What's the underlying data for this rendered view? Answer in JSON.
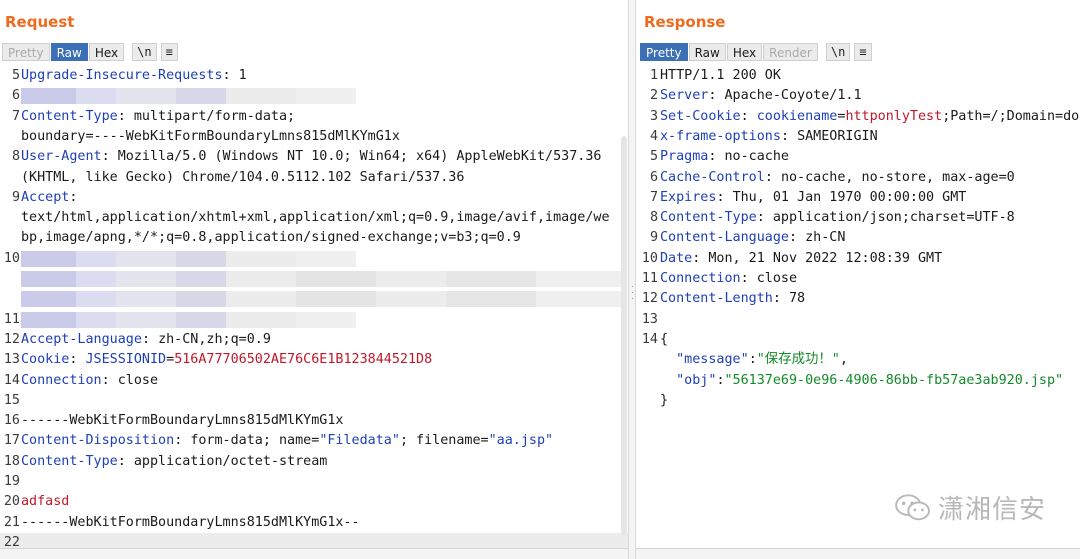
{
  "request": {
    "title": "Request",
    "tabs": [
      {
        "label": "Pretty",
        "state": "disabled"
      },
      {
        "label": "Raw",
        "state": "active"
      },
      {
        "label": "Hex",
        "state": "normal"
      }
    ],
    "newline_label": "\\n",
    "menu_label": "≡",
    "lines": [
      {
        "n": "5",
        "key": "Upgrade-Insecure-Requests",
        "sep": ": ",
        "val": "1"
      },
      {
        "n": "6",
        "redacted": true
      },
      {
        "n": "7",
        "key": "Content-Type",
        "sep": ": ",
        "val": "multipart/form-data;"
      },
      {
        "n": "",
        "val": "boundary=----WebKitFormBoundaryLmns815dMlKYmG1x"
      },
      {
        "n": "8",
        "key": "User-Agent",
        "sep": ": ",
        "val": "Mozilla/5.0 (Windows NT 10.0; Win64; x64) AppleWebKit/537.36"
      },
      {
        "n": "",
        "val": "(KHTML, like Gecko) Chrome/104.0.5112.102 Safari/537.36"
      },
      {
        "n": "9",
        "key": "Accept",
        "sep": ":",
        "val": ""
      },
      {
        "n": "",
        "val": "text/html,application/xhtml+xml,application/xml;q=0.9,image/avif,image/we"
      },
      {
        "n": "",
        "val": "bp,image/apng,*/*;q=0.8,application/signed-exchange;v=b3;q=0.9"
      },
      {
        "n": "10",
        "redacted": true
      },
      {
        "n": "",
        "redacted": true
      },
      {
        "n": "",
        "redacted": true
      },
      {
        "n": "11",
        "redacted": true
      },
      {
        "n": "12",
        "key": "Accept-Language",
        "sep": ": ",
        "val": "zh-CN,zh;q=0.9"
      },
      {
        "n": "13",
        "key": "Cookie",
        "sep": ": ",
        "ckey": "JSESSIONID",
        "ceq": "=",
        "cval": "516A77706502AE76C6E1B123844521D8"
      },
      {
        "n": "14",
        "key": "Connection",
        "sep": ": ",
        "val": "close"
      },
      {
        "n": "15",
        "val": ""
      },
      {
        "n": "16",
        "val": "------WebKitFormBoundaryLmns815dMlKYmG1x"
      },
      {
        "n": "17",
        "key": "Content-Disposition",
        "sep": ": ",
        "val": "form-data; name=",
        "q1": "\"Filedata\"",
        "mid": "; filename=",
        "q2": "\"aa.jsp\""
      },
      {
        "n": "18",
        "key": "Content-Type",
        "sep": ": ",
        "val": "application/octet-stream"
      },
      {
        "n": "19",
        "val": ""
      },
      {
        "n": "20",
        "red": "adfasd"
      },
      {
        "n": "21",
        "val": "------WebKitFormBoundaryLmns815dMlKYmG1x--"
      },
      {
        "n": "22",
        "val": ""
      }
    ]
  },
  "response": {
    "title": "Response",
    "tabs": [
      {
        "label": "Pretty",
        "state": "active"
      },
      {
        "label": "Raw",
        "state": "normal"
      },
      {
        "label": "Hex",
        "state": "normal"
      },
      {
        "label": "Render",
        "state": "disabled"
      }
    ],
    "newline_label": "\\n",
    "menu_label": "≡",
    "lines": [
      {
        "n": "1",
        "val": "HTTP/1.1 200 OK"
      },
      {
        "n": "2",
        "key": "Server",
        "sep": ": ",
        "val": "Apache-Coyote/1.1"
      },
      {
        "n": "3",
        "key": "Set-Cookie",
        "sep": ": ",
        "ckey": "cookiename",
        "ceq": "=",
        "cval": "httponlyTest",
        "rest": ";Path=/;Domain=do"
      },
      {
        "n": "4",
        "key": "x-frame-options",
        "sep": ": ",
        "val": "SAMEORIGIN"
      },
      {
        "n": "5",
        "key": "Pragma",
        "sep": ": ",
        "val": "no-cache"
      },
      {
        "n": "6",
        "key": "Cache-Control",
        "sep": ": ",
        "val": "no-cache, no-store, max-age=0"
      },
      {
        "n": "7",
        "key": "Expires",
        "sep": ": ",
        "val": "Thu, 01 Jan 1970 00:00:00 GMT"
      },
      {
        "n": "8",
        "key": "Content-Type",
        "sep": ": ",
        "val": "application/json;charset=UTF-8"
      },
      {
        "n": "9",
        "key": "Content-Language",
        "sep": ": ",
        "val": "zh-CN"
      },
      {
        "n": "10",
        "key": "Date",
        "sep": ": ",
        "val": "Mon, 21 Nov 2022 12:08:39 GMT"
      },
      {
        "n": "11",
        "key": "Connection",
        "sep": ": ",
        "val": "close"
      },
      {
        "n": "12",
        "key": "Content-Length",
        "sep": ": ",
        "val": "78"
      },
      {
        "n": "13",
        "val": ""
      },
      {
        "n": "14",
        "val": "{"
      },
      {
        "n": "",
        "indent": "  ",
        "jk": "\"message\"",
        "jc": ":",
        "jv": "\"保存成功！\"",
        "tail": ","
      },
      {
        "n": "",
        "indent": "  ",
        "jk": "\"obj\"",
        "jc": ":",
        "jv": "\"56137e69-0e96-4906-86bb-fb57ae3ab920.jsp\"",
        "tail": ""
      },
      {
        "n": "",
        "val": "}"
      }
    ]
  },
  "watermark": {
    "text": "潇湘信安",
    "icon": "wechat-icon"
  },
  "colors": {
    "accent": "#ef6a1f",
    "active_tab": "#3b6fb6",
    "header_key": "#1f3fb5",
    "cookie_value": "#c0182a",
    "json_string": "#138a28"
  }
}
